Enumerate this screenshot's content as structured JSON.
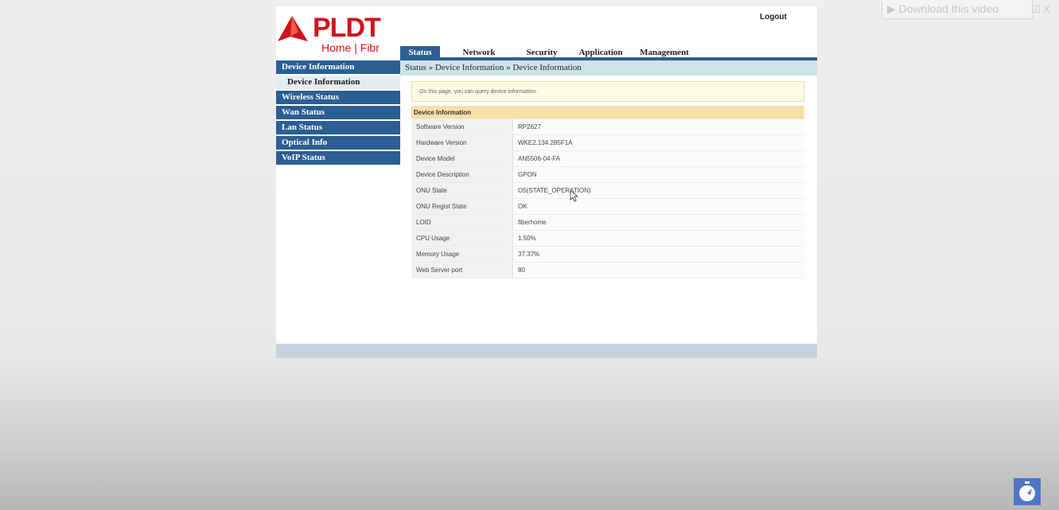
{
  "brand": {
    "name": "PLDT",
    "tagline": "Home | Fibr",
    "color": "#d0131b"
  },
  "header": {
    "logout": "Logout"
  },
  "nav": [
    "Status",
    "Network",
    "Security",
    "Application",
    "Management"
  ],
  "nav_active": "Status",
  "sidebar": {
    "items": [
      {
        "label": "Device Information"
      },
      {
        "label": "Device Information",
        "sub": true
      },
      {
        "label": "Wireless Status"
      },
      {
        "label": "Wan Status"
      },
      {
        "label": "Lan Status"
      },
      {
        "label": "Optical Info"
      },
      {
        "label": "VoIP Status"
      }
    ]
  },
  "main": {
    "breadcrumb": "Status » Device Information » Device Information",
    "notice": "On this page, you can query device information.",
    "table_title": "Device Information",
    "rows": [
      {
        "label": "Software Version",
        "value": "RP2627"
      },
      {
        "label": "Hardware Version",
        "value": "WKE2.134.285F1A"
      },
      {
        "label": "Device Model",
        "value": "AN5506-04-FA"
      },
      {
        "label": "Device Description",
        "value": "GPON"
      },
      {
        "label": "ONU State",
        "value": "O5(STATE_OPERATION)"
      },
      {
        "label": "ONU Regist State",
        "value": "OK"
      },
      {
        "label": "LOID",
        "value": "fiberhome"
      },
      {
        "label": "CPU Usage",
        "value": "1.50%"
      },
      {
        "label": "Memory Usage",
        "value": "37.37%"
      },
      {
        "label": "Web Server port",
        "value": "80"
      }
    ]
  },
  "overlay": {
    "download": "Download this video",
    "close": "☑ X"
  },
  "colors": {
    "nav_blue": "#2c5f95",
    "breadcrumb_bg": "#cfe2ec",
    "table_head": "#f6dfa8"
  }
}
